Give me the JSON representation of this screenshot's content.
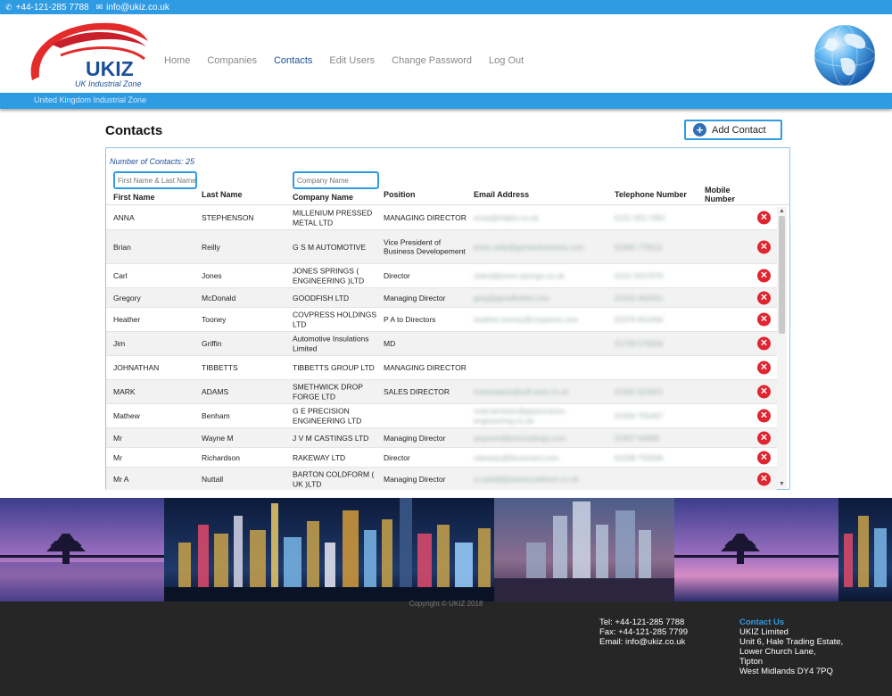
{
  "topbar": {
    "phone": "+44-121-285 7788",
    "email": "info@ukiz.co.uk",
    "phone_icon": "phone-icon",
    "email_icon": "envelope-icon"
  },
  "brand": {
    "name": "UKIZ",
    "tagline": "UK Industrial Zone",
    "strapline": "United Kingdom Industrial Zone"
  },
  "nav": [
    {
      "label": "Home",
      "active": false
    },
    {
      "label": "Companies",
      "active": false
    },
    {
      "label": "Contacts",
      "active": true
    },
    {
      "label": "Edit Users",
      "active": false
    },
    {
      "label": "Change Password",
      "active": false
    },
    {
      "label": "Log Out",
      "active": false
    }
  ],
  "page": {
    "title": "Contacts",
    "add_button": "Add Contact",
    "count_label": "Number of Contacts: 25"
  },
  "filters": {
    "name_placeholder": "First Name & Last Name",
    "company_placeholder": "Company Name"
  },
  "table": {
    "headers": {
      "first": "First Name",
      "last": "Last Name",
      "company": "Company Name",
      "position": "Position",
      "email": "Email Address",
      "telephone": "Telephone Number",
      "mobile": "Mobile Number"
    },
    "rows": [
      {
        "first": "ANNA",
        "last": "STEPHENSON",
        "company": "MILLENIUM PRESSED METAL LTD",
        "position": "MANAGING DIRECTOR",
        "email": "anna@milpm.co.uk",
        "tel": "0121 553 7481",
        "h": 27
      },
      {
        "first": "Brian",
        "last": "Reilly",
        "company": "G S M AUTOMOTIVE",
        "position": "Vice President of Business Developement",
        "email": "brian.reilly@gsmautomotive.com",
        "tel": "01865 776511",
        "h": 38
      },
      {
        "first": "Carl",
        "last": "Jones",
        "company": "JONES SPRINGS ( ENGINEERING )LTD",
        "position": "Director",
        "email": "sales@jones-springs.co.uk",
        "tel": "0121 5557070",
        "h": 27
      },
      {
        "first": "Gregory",
        "last": "McDonald",
        "company": "GOODFISH LTD",
        "position": "Managing Director",
        "email": "greg@goodfishltd.com",
        "tel": "01543 462561",
        "h": 22
      },
      {
        "first": "Heather",
        "last": "Tooney",
        "company": "COVPRESS HOLDINGS LTD",
        "position": "P A to Directors",
        "email": "heather.tooney@covpress.com",
        "tel": "02476 651666",
        "h": 27
      },
      {
        "first": "Jim",
        "last": "Griffin",
        "company": "Automotive Insulations Limited",
        "position": "MD",
        "email": "",
        "tel": "01758 078306",
        "h": 27
      },
      {
        "first": "JOHNATHAN",
        "last": "TIBBETTS",
        "company": "TIBBETTS GROUP LTD",
        "position": "MANAGING DIRECTOR",
        "email": "",
        "tel": "",
        "h": 27
      },
      {
        "first": "MARK",
        "last": "ADAMS",
        "company": "SMETHWICK DROP FORGE LTD",
        "position": "SALES DIRECTOR",
        "email": "markadams@sdf-auto.co.uk",
        "tel": "01902 823451",
        "h": 27
      },
      {
        "first": "Mathew",
        "last": "Benham",
        "company": "G E PRECISION ENGINEERING LTD",
        "position": "",
        "email": "matt.benham@geprecision-engineering.co.uk",
        "tel": "01604 755467",
        "h": 27
      },
      {
        "first": "Mr",
        "last": "Wayne M",
        "company": "J V M CASTINGS LTD",
        "position": "Managing Director",
        "email": "waynem@jvmcastings.com",
        "tel": "01827 64896",
        "h": 22
      },
      {
        "first": "Mr",
        "last": "Richardson",
        "company": "RAKEWAY LTD",
        "position": "Director",
        "email": "rakeway@btconnect.com",
        "tel": "01538 755566",
        "h": 22
      },
      {
        "first": "Mr A",
        "last": "Nuttall",
        "company": "BARTON COLDFORM ( UK )LTD",
        "position": "Managing Director",
        "email": "a.nuttall@bartoncoldform.co.uk",
        "tel": "",
        "h": 27
      }
    ]
  },
  "banner": {
    "description": "city-skyline-at-night-banner"
  },
  "footer": {
    "copyright": "Copyright © UKIZ 2018",
    "tel": "Tel: +44-121-285 7788",
    "fax": "Fax: +44-121-285 7799",
    "email": "Email: info@ukiz.co.uk",
    "contact_title": "Contact Us",
    "address": [
      "UKIZ Limited",
      "Unit 6, Hale Trading Estate,",
      "Lower Church Lane,",
      "Tipton",
      "West Midlands DY4 7PQ"
    ]
  },
  "colors": {
    "accent": "#2f9be3",
    "brand": "#1c4f9a",
    "delete": "#e0252f",
    "footer": "#262626"
  }
}
